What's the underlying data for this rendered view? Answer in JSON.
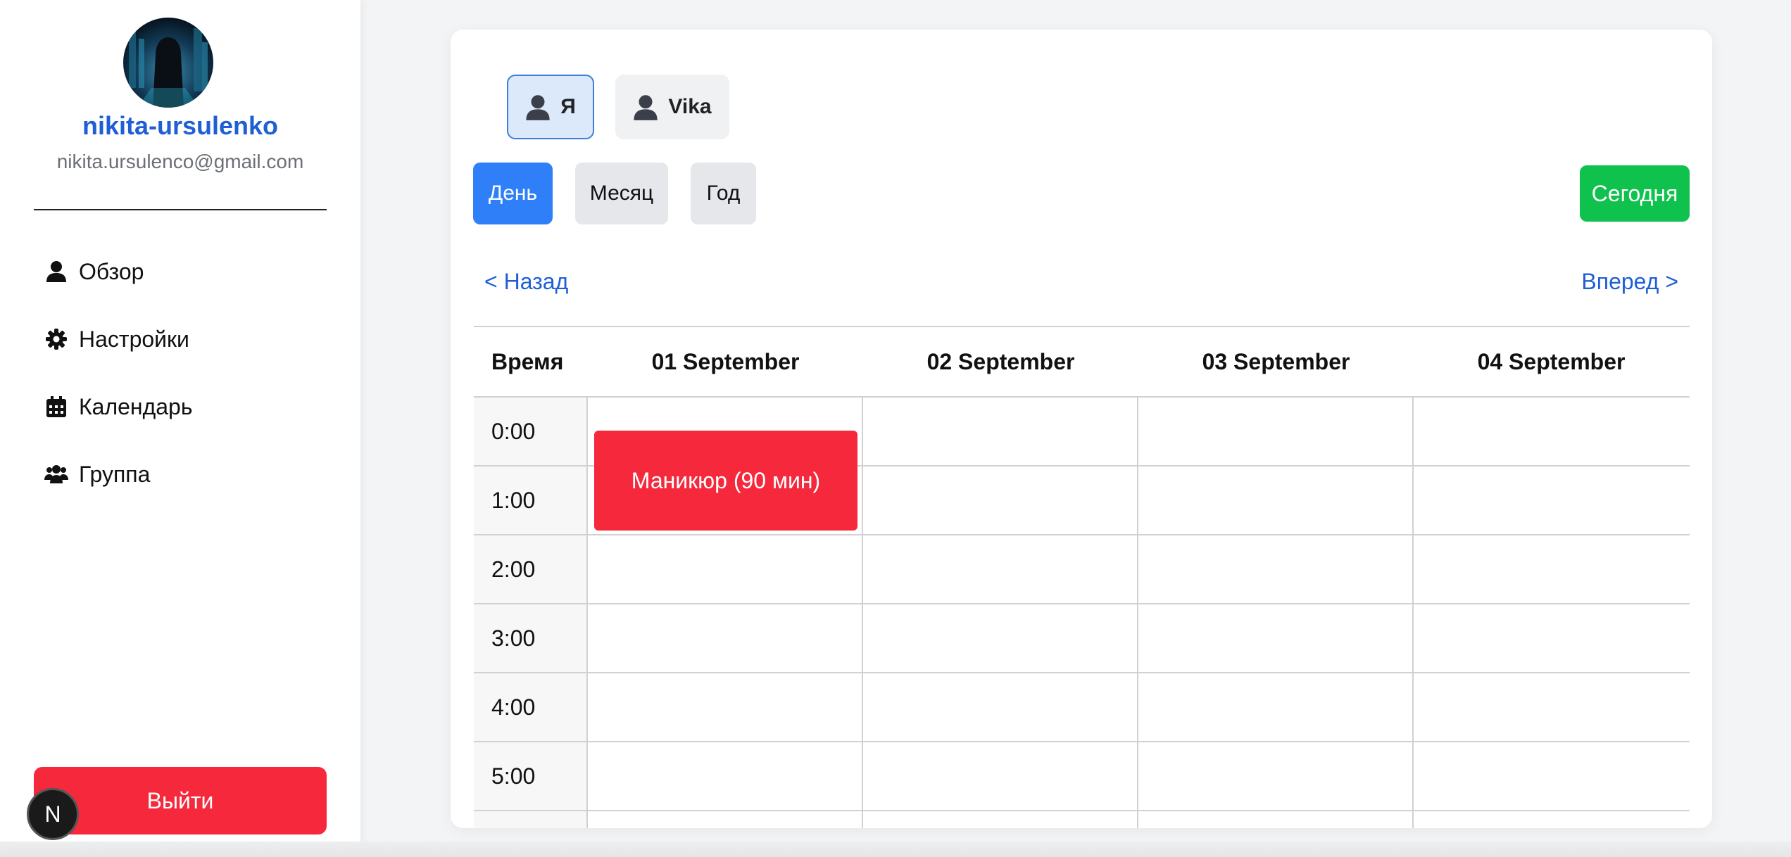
{
  "profile": {
    "username": "nikita-ursulenko",
    "email": "nikita.ursulenco@gmail.com"
  },
  "sidebar": {
    "items": [
      {
        "label": "Обзор",
        "icon": "user-icon"
      },
      {
        "label": "Настройки",
        "icon": "gear-icon"
      },
      {
        "label": "Календарь",
        "icon": "calendar-icon"
      },
      {
        "label": "Группа",
        "icon": "group-icon"
      }
    ],
    "logout_label": "Выйти",
    "badge_letter": "N"
  },
  "users": [
    {
      "label": "Я",
      "selected": true
    },
    {
      "label": "Vika",
      "selected": false
    }
  ],
  "views": {
    "day": "День",
    "month": "Месяц",
    "year": "Год",
    "today": "Сегодня"
  },
  "nav": {
    "back": "< Назад",
    "forward": "Вперед >"
  },
  "calendar": {
    "time_header": "Время",
    "days": [
      "01 September",
      "02 September",
      "03 September",
      "04 September"
    ],
    "hours": [
      "0:00",
      "1:00",
      "2:00",
      "3:00",
      "4:00",
      "5:00",
      ""
    ],
    "event": {
      "label": "Маникюр (90 мин)",
      "color": "#f5283c"
    }
  },
  "colors": {
    "accent": "#2f80f8",
    "today": "#0fc24d",
    "danger": "#f5283c",
    "link": "#1f5fd6"
  }
}
